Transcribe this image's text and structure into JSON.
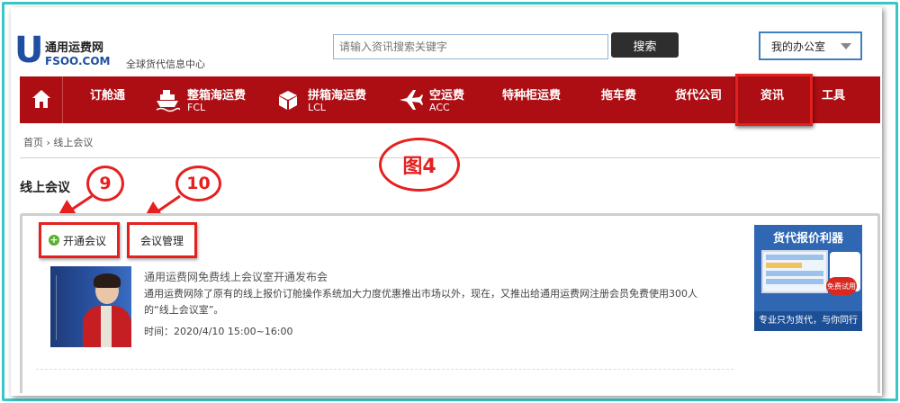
{
  "header": {
    "logo_letter": "U",
    "site_name": "通用运费网",
    "domain": "FSOO.COM",
    "slogan": "全球货代信息中心",
    "search_placeholder": "请输入资讯搜索关键字",
    "search_button": "搜索",
    "office_menu": "我的办公室"
  },
  "nav": {
    "items": [
      {
        "label": "订舱通",
        "sub": ""
      },
      {
        "label": "整箱海运费",
        "sub": "FCL"
      },
      {
        "label": "拼箱海运费",
        "sub": "LCL"
      },
      {
        "label": "空运费",
        "sub": "ACC"
      },
      {
        "label": "特种柜运费",
        "sub": ""
      },
      {
        "label": "拖车费",
        "sub": ""
      },
      {
        "label": "货代公司",
        "sub": ""
      },
      {
        "label": "资讯",
        "sub": ""
      },
      {
        "label": "工具",
        "sub": ""
      }
    ]
  },
  "breadcrumb": {
    "home": "首页",
    "separator": "›",
    "current": "线上会议"
  },
  "annotations": {
    "figure": "图4",
    "step9": "9",
    "step10": "10"
  },
  "main": {
    "title": "线上会议",
    "open_meeting": "开通会议",
    "manage_meeting": "会议管理",
    "article": {
      "title": "通用运费网免费线上会议室开通发布会",
      "description": "通用运费网除了原有的线上报价订舱操作系统加大力度优惠推出市场以外，现在，又推出给通用运费网注册会员免费使用300人的“线上会议室”。",
      "time": "时间：2020/4/10 15:00~16:00"
    }
  },
  "ad": {
    "title": "货代报价利器",
    "badge": "免费试用",
    "footer": "专业只为货代，与你同行"
  },
  "colors": {
    "nav_red": "#ad0e14",
    "brand_blue": "#1f4fa2",
    "annotation_red": "#e5201f",
    "frame_cyan": "#39c6c8"
  }
}
